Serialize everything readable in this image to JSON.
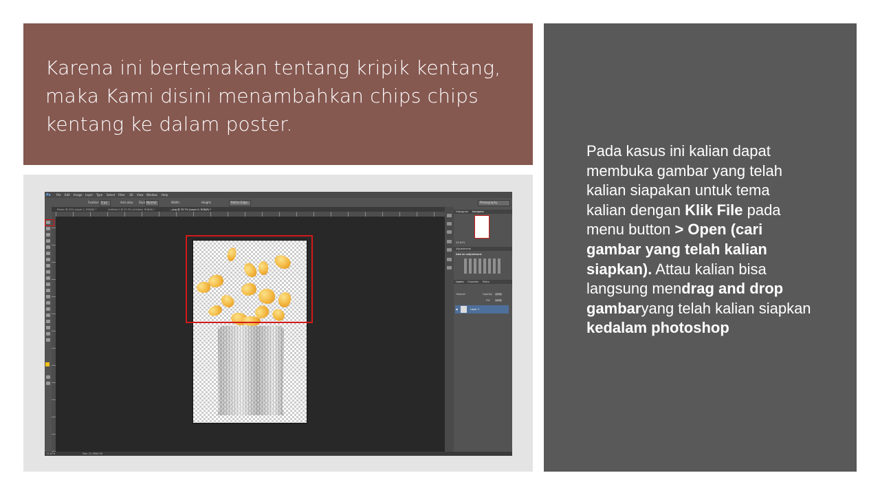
{
  "slide": {
    "title": "Karena ini bertemakan tentang kripik kentang, maka Kami disini menambahkan chips chips kentang ke dalam poster.",
    "body": {
      "t1": "Pada kasus ini kalian dapat membuka gambar yang telah kalian siapakan untuk tema kalian dengan ",
      "b1": "Klik File",
      "t2": " pada menu button ",
      "b2": "> Open (cari gambar yang telah kalian siapkan).",
      "t3": " Attau kalian bisa langsung men",
      "b3": "drag and drop gambar",
      "t4": "yang telah kalian siapkan ",
      "b4": "kedalam photoshop"
    },
    "colors": {
      "title_bg": "#855850",
      "right_bg": "#595959",
      "screenshot_frame": "#e4e4e4",
      "highlight": "#d21a1a"
    }
  },
  "photoshop": {
    "logo": "Ps",
    "menu": [
      "File",
      "Edit",
      "Image",
      "Layer",
      "Type",
      "Select",
      "Filter",
      "3D",
      "View",
      "Window",
      "Help"
    ],
    "options": {
      "feather_label": "Feather:",
      "feather_value": "0 px",
      "antialias": "Anti-alias",
      "style_label": "Style:",
      "style_value": "Normal",
      "width_label": "Width:",
      "height_label": "Height:",
      "refine_edge": "Refine Edge...",
      "workspace": "Photography"
    },
    "tabs": [
      "Poster @ 25% (Layer 1, RGB/8) *",
      "Untitled-1 @ 33.3% (Untitled, RGB/8) *",
      "...png @ 33.7% (Layer 0, RGB/8) *"
    ],
    "panels": {
      "top_tabs": [
        "Histogram",
        "Navigator"
      ],
      "zoom": "33.67%",
      "adjustments_title": "Adjustments",
      "adjustments_hint": "Add an adjustment",
      "layers_tabs": [
        "Layers",
        "Channels",
        "Paths"
      ],
      "blend_mode": "Normal",
      "opacity_label": "Opacity:",
      "opacity_value": "100%",
      "fill_label": "Fill:",
      "fill_value": "100%",
      "layer_name": "Layer 1"
    },
    "status": {
      "zoom": "33.67%",
      "doc": "Doc: 21.2M/0.00",
      "bottom": "Mini Bridge"
    }
  }
}
